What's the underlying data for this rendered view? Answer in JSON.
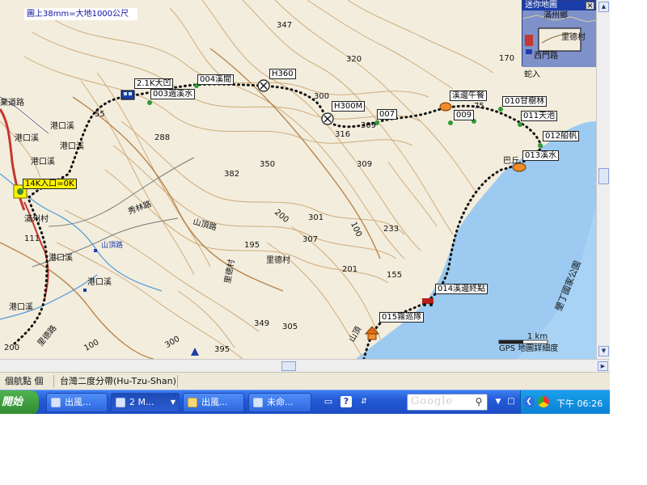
{
  "map": {
    "scale_note": "圖上38mm=大地1000公尺",
    "elevations": [
      "347",
      "320",
      "170",
      "蛇入",
      "300",
      "288",
      "350",
      "382",
      "309",
      "316",
      "309",
      "301",
      "307",
      "233",
      "201",
      "155",
      "195",
      "349",
      "305",
      "395",
      "111",
      "55",
      "75",
      "200",
      "100",
      "200",
      "300",
      "100"
    ],
    "place_names": [
      "港口溪",
      "港口溪",
      "港口溪",
      "港口溪",
      "港口溪",
      "港口溪",
      "港口溪",
      "港口溪",
      "業道路",
      "滿州村",
      "里德村",
      "里德路",
      "港口溪",
      "山頂路",
      "秀林路",
      "山頂路",
      "里德村",
      "山頂",
      "巴丘",
      "墾丁國家公園"
    ],
    "waypoints": [
      "2.1K大凹",
      "003過溪水",
      "004溪間",
      "H360",
      "H300M",
      "007",
      "009",
      "溪邊午餐",
      "010甘樹林",
      "011天池",
      "012船帆",
      "013溪水",
      "014溪邊終點",
      "015霧巡隊",
      "14K入口=0K"
    ],
    "scale_bar": "1 km",
    "detail_label": "GPS 地圖詳細度"
  },
  "minimap": {
    "title": "迷你地圖",
    "close": "✕",
    "labels": [
      "滿州鄉",
      "里德村",
      "西門路"
    ]
  },
  "status_bar": {
    "left": "個航點 個",
    "datum": "台灣二度分帶(Hu-Tzu-Shan)"
  },
  "taskbar": {
    "start": "開始",
    "tasks": [
      "出風...",
      "2 M...",
      "出風...",
      "未命..."
    ],
    "search_logo": "Google",
    "clock": "下午 06:26"
  },
  "colors": {
    "map_background": "#f3eddd",
    "contour": "#c9a06b",
    "sea": "#9ccaf0",
    "route": "#111111",
    "taskbar": "#2359d6"
  }
}
